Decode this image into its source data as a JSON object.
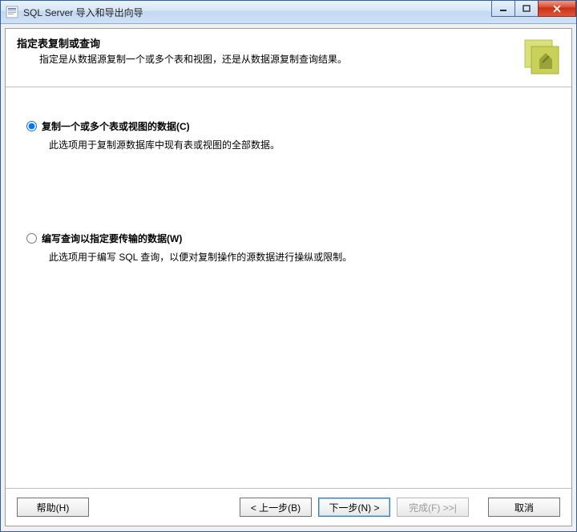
{
  "window": {
    "title": "SQL Server 导入和导出向导"
  },
  "header": {
    "title": "指定表复制或查询",
    "subtitle": "指定是从数据源复制一个或多个表和视图，还是从数据源复制查询结果。"
  },
  "options": {
    "copy": {
      "label": "复制一个或多个表或视图的数据(C)",
      "desc": "此选项用于复制源数据库中现有表或视图的全部数据。",
      "checked": true
    },
    "query": {
      "label": "编写查询以指定要传输的数据(W)",
      "desc": "此选项用于编写 SQL 查询，以便对复制操作的源数据进行操纵或限制。",
      "checked": false
    }
  },
  "buttons": {
    "help": "帮助(H)",
    "back": "< 上一步(B)",
    "next": "下一步(N) >",
    "finish": "完成(F) >>|",
    "cancel": "取消"
  }
}
